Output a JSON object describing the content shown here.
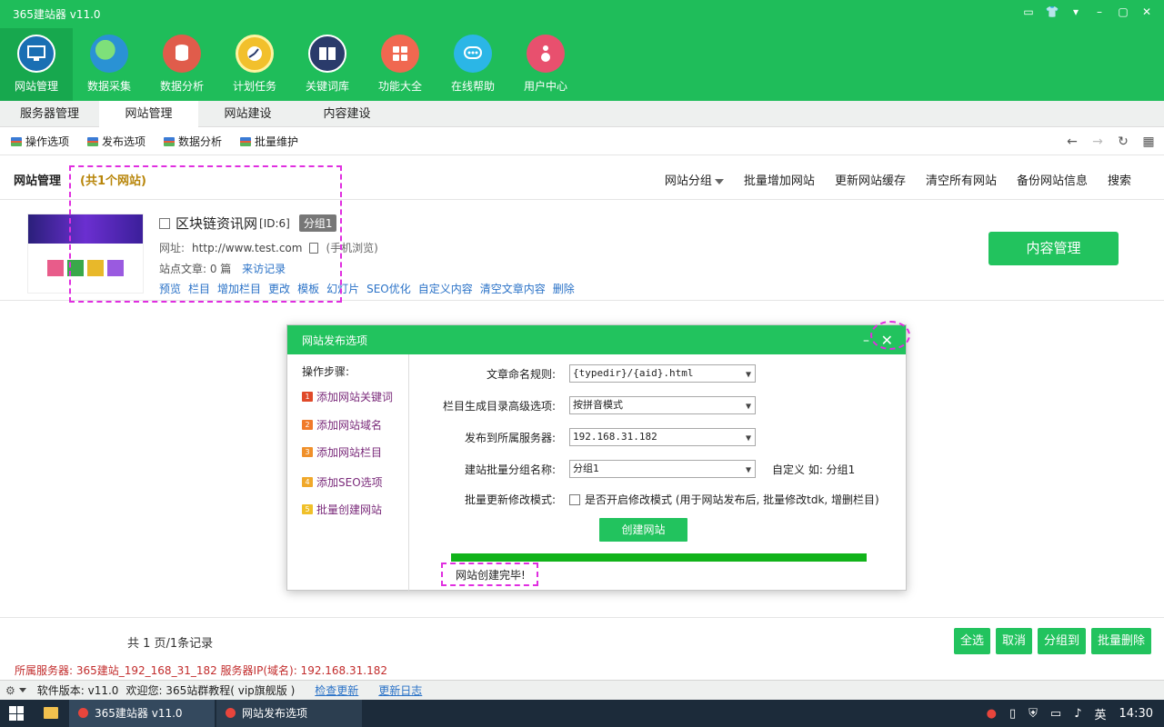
{
  "window": {
    "title": "365建站器 v11.0",
    "controls": [
      "▭",
      "👕",
      "▾",
      "–",
      "▢",
      "✕"
    ]
  },
  "main_tools": [
    {
      "label": "网站管理",
      "color": "#1a6fb3"
    },
    {
      "label": "数据采集",
      "color": "#2a92d4"
    },
    {
      "label": "数据分析",
      "color": "#e05c4b"
    },
    {
      "label": "计划任务",
      "color": "#f2c02c"
    },
    {
      "label": "关键词库",
      "color": "#2a3b6b"
    },
    {
      "label": "功能大全",
      "color": "#f06850"
    },
    {
      "label": "在线帮助",
      "color": "#2bb6e6"
    },
    {
      "label": "用户中心",
      "color": "#e8506e"
    }
  ],
  "tabs": [
    "服务器管理",
    "网站管理",
    "网站建设",
    "内容建设"
  ],
  "subtoolbar": [
    "操作选项",
    "发布选项",
    "数据分析",
    "批量维护"
  ],
  "sitehead": {
    "title": "网站管理",
    "count": "(共1个网站)",
    "actions": [
      "网站分组",
      "批量增加网站",
      "更新网站缓存",
      "清空所有网站",
      "备份网站信息",
      "搜索"
    ]
  },
  "site": {
    "name": "区块链资讯网",
    "id": "[ID:6]",
    "group": "分组1",
    "url_label": "网址:",
    "url": "http://www.test.com",
    "mobile": "(手机浏览)",
    "article_label": "站点文章: 0 篇",
    "visit": "来访记录",
    "links": [
      "预览",
      "栏目",
      "增加栏目",
      "更改",
      "模板",
      "幻灯片",
      "SEO优化",
      "自定义内容",
      "清空文章内容",
      "删除"
    ],
    "content_button": "内容管理"
  },
  "dialog": {
    "title": "网站发布选项",
    "min": "–",
    "close": "✕",
    "steps_title": "操作步骤:",
    "steps": [
      {
        "num": "1",
        "label": "添加网站关键词",
        "color": "#e04a2a"
      },
      {
        "num": "2",
        "label": "添加网站域名",
        "color": "#f07a2a"
      },
      {
        "num": "3",
        "label": "添加网站栏目",
        "color": "#f0902a"
      },
      {
        "num": "4",
        "label": "添加SEO选项",
        "color": "#f0a82a"
      },
      {
        "num": "5",
        "label": "批量创建网站",
        "color": "#f0c02a"
      }
    ],
    "fields": {
      "naming_label": "文章命名规则:",
      "naming_value": "{typedir}/{aid}.html",
      "column_label": "栏目生成目录高级选项:",
      "column_value": "按拼音模式",
      "server_label": "发布到所属服务器:",
      "server_value": "192.168.31.182",
      "group_label": "建站批量分组名称:",
      "group_value": "分组1",
      "group_note": "自定义 如: 分组1",
      "mode_label": "批量更新修改模式:",
      "mode_text": "是否开启修改模式 (用于网站发布后, 批量修改tdk, 增删栏目)"
    },
    "create_button": "创建网站",
    "progress": 1.0,
    "done_text": "网站创建完毕!"
  },
  "pager": {
    "info": "共 1 页/1条记录",
    "buttons": [
      "全选",
      "取消",
      "分组到",
      "批量删除"
    ]
  },
  "server_line": "所属服务器: 365建站_192_168_31_182 服务器IP(域名): 192.168.31.182",
  "statusbar": {
    "version": "软件版本: v11.0",
    "welcome": "欢迎您: 365站群教程( vip旗舰版 )",
    "check_update": "检查更新",
    "update_log": "更新日志"
  },
  "taskbar": {
    "apps": [
      "365建站器 v11.0",
      "网站发布选项"
    ],
    "ime": "英",
    "time": "14:30"
  }
}
